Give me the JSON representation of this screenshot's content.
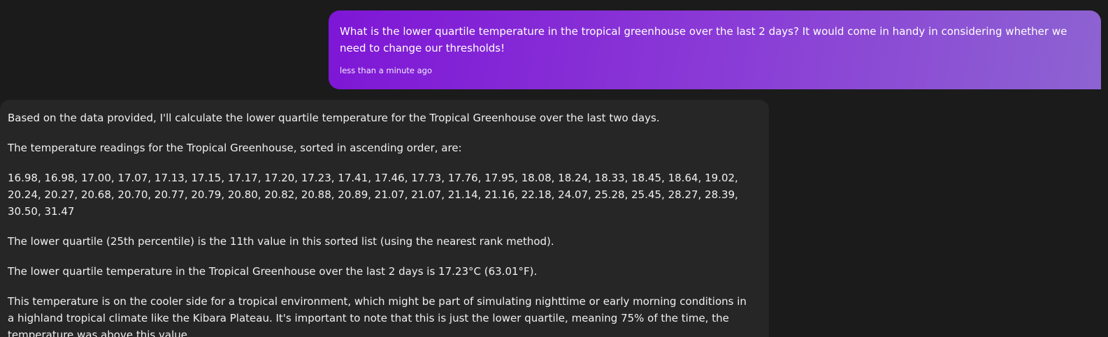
{
  "user_message": {
    "text": "What is the lower quartile temperature in the tropical greenhouse over the last 2 days? It would come in handy in considering whether we need to change our thresholds!",
    "timestamp": "less than a minute ago"
  },
  "assistant_message": {
    "paragraphs": [
      "Based on the data provided, I'll calculate the lower quartile temperature for the Tropical Greenhouse over the last two days.",
      "The temperature readings for the Tropical Greenhouse, sorted in ascending order, are:",
      "16.98, 16.98, 17.00, 17.07, 17.13, 17.15, 17.17, 17.20, 17.23, 17.41, 17.46, 17.73, 17.76, 17.95, 18.08, 18.24, 18.33, 18.45, 18.64, 19.02, 20.24, 20.27, 20.68, 20.70, 20.77, 20.79, 20.80, 20.82, 20.88, 20.89, 21.07, 21.07, 21.14, 21.16, 22.18, 24.07, 25.28, 25.45, 28.27, 28.39, 30.50, 31.47",
      "The lower quartile (25th percentile) is the 11th value in this sorted list (using the nearest rank method).",
      "The lower quartile temperature in the Tropical Greenhouse over the last 2 days is 17.23°C (63.01°F).",
      "This temperature is on the cooler side for a tropical environment, which might be part of simulating nighttime or early morning conditions in a highland tropical climate like the Kibara Plateau. It's important to note that this is just the lower quartile, meaning 75% of the time, the temperature was above this value."
    ]
  },
  "colors": {
    "background": "#1b1b1b",
    "user_bubble_start": "#7e16d6",
    "user_bubble_end": "#8d63d2",
    "assistant_bubble": "#262626"
  }
}
